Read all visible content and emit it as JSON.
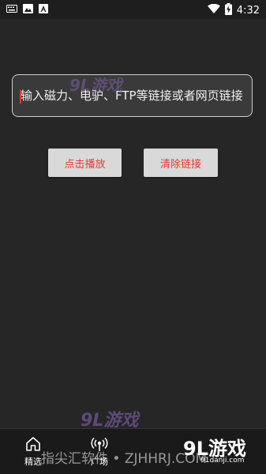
{
  "status_bar": {
    "time": "4:32",
    "left_icons": [
      "keyboard-icon",
      "image-icon",
      "text-icon"
    ],
    "right_icons": [
      "wifi-icon",
      "battery-charging-icon"
    ]
  },
  "link_input": {
    "placeholder": "输入磁力、电驴、FTP等链接或者网页链接",
    "value": ""
  },
  "buttons": {
    "play_label": "点击播放",
    "clear_label": "清除链接",
    "text_color": "#e53935"
  },
  "bottom_nav": {
    "items": [
      {
        "label": "精选",
        "icon": "home-icon"
      },
      {
        "label": "广场",
        "icon": "broadcast-icon"
      }
    ]
  },
  "watermark": {
    "top_logo": "9L游戏",
    "mid_logo": "9L游戏",
    "bottom_text": "指尖汇软件 • ZJHHRJ.COM",
    "corner_logo": "9L游戏",
    "corner_url": "91danji.com"
  }
}
